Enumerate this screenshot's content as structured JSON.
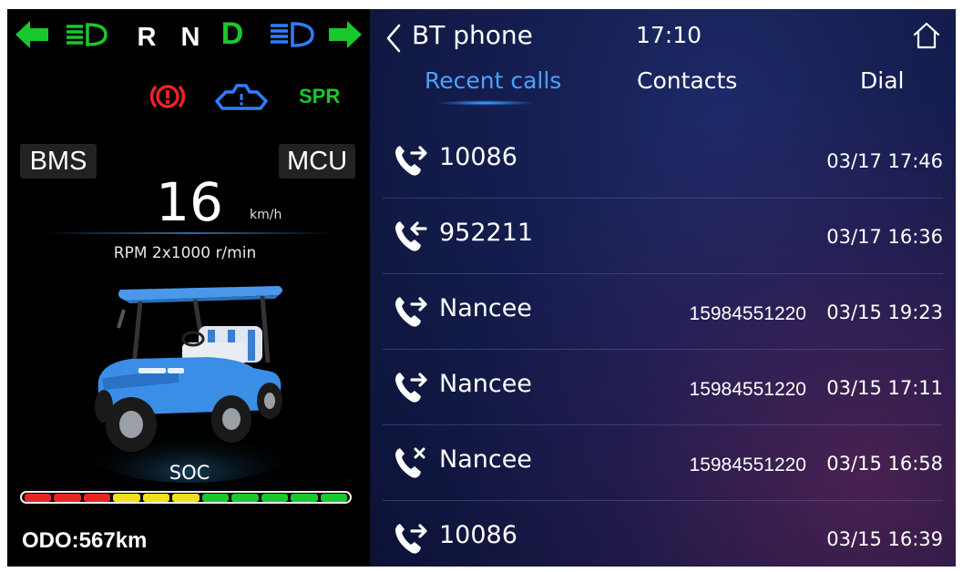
{
  "cluster": {
    "gears": [
      "R",
      "N",
      "D"
    ],
    "active_gear": "D",
    "tags": {
      "bms": "BMS",
      "mcu": "MCU"
    },
    "spr": "SPR",
    "speed": "16",
    "speed_unit": "km/h",
    "rpm": "RPM 2x1000 r/min",
    "soc_label": "SOC",
    "soc_segments": [
      "#e82424",
      "#e82424",
      "#e82424",
      "#f0e020",
      "#f0e020",
      "#f0e020",
      "#19c82d",
      "#19c82d",
      "#19c82d",
      "#19c82d",
      "#19c82d"
    ],
    "odo": "ODO:567km",
    "colors": {
      "green": "#19c82d",
      "red": "#e82424",
      "blue": "#2f7dff",
      "cart_blue": "#3a8ee6"
    }
  },
  "phone": {
    "title": "BT phone",
    "clock": "17:10",
    "tabs": [
      "Recent calls",
      "Contacts",
      "Dial"
    ],
    "active_tab": "Recent calls",
    "calls": [
      {
        "type": "outgoing",
        "name": "10086",
        "number": "",
        "time": "03/17  17:46"
      },
      {
        "type": "incoming",
        "name": "952211",
        "number": "",
        "time": "03/17  16:36"
      },
      {
        "type": "outgoing",
        "name": "Nancee",
        "number": "15984551220",
        "time": "03/15  19:23"
      },
      {
        "type": "outgoing",
        "name": "Nancee",
        "number": "15984551220",
        "time": "03/15  17:11"
      },
      {
        "type": "missed",
        "name": "Nancee",
        "number": "15984551220",
        "time": "03/15  16:58"
      },
      {
        "type": "outgoing",
        "name": "10086",
        "number": "",
        "time": "03/15  16:39"
      }
    ],
    "colors": {
      "accent": "#4aa3ff",
      "divider": "#6e82be"
    }
  }
}
